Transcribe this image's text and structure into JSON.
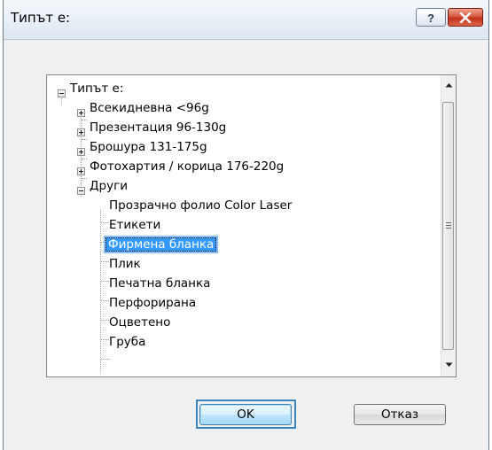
{
  "window": {
    "title": "Типът е:",
    "help_glyph": "?",
    "close_glyph": "✕"
  },
  "tree": {
    "root": {
      "label": "Типът е:",
      "expanded": true
    },
    "items": [
      {
        "label": "Всекидневна <96g",
        "expanded": false
      },
      {
        "label": "Презентация 96-130g",
        "expanded": false
      },
      {
        "label": "Брошура 131-175g",
        "expanded": false
      },
      {
        "label": "Фотохартия / корица 176-220g",
        "expanded": false
      },
      {
        "label": "Други",
        "expanded": true
      }
    ],
    "children": [
      {
        "label": "Прозрачно фолио Color Laser"
      },
      {
        "label": "Етикети"
      },
      {
        "label": "Фирмена бланка",
        "selected": true
      },
      {
        "label": "Плик"
      },
      {
        "label": "Печатна бланка"
      },
      {
        "label": "Перфорирана"
      },
      {
        "label": "Оцветено"
      },
      {
        "label": "Груба"
      }
    ]
  },
  "buttons": {
    "ok": "OK",
    "cancel": "Отказ"
  },
  "colors": {
    "selection": "#3399ff",
    "focus_border": "#3c85c1",
    "close_red": "#c33018"
  }
}
